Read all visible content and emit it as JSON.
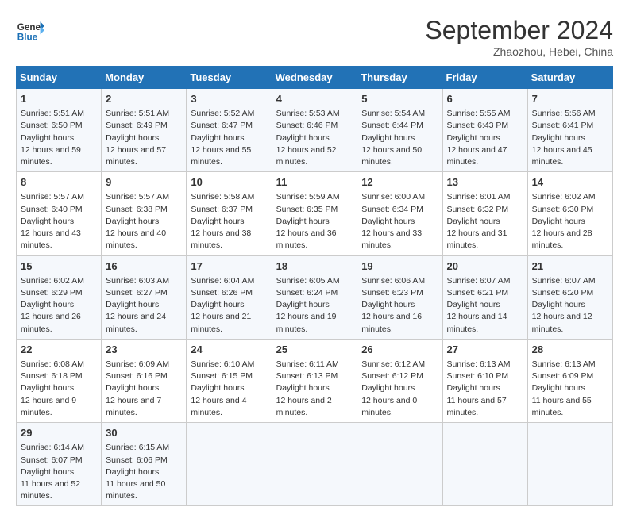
{
  "header": {
    "logo_line1": "General",
    "logo_line2": "Blue",
    "month": "September 2024",
    "location": "Zhaozhou, Hebei, China"
  },
  "weekdays": [
    "Sunday",
    "Monday",
    "Tuesday",
    "Wednesday",
    "Thursday",
    "Friday",
    "Saturday"
  ],
  "weeks": [
    [
      {
        "day": "1",
        "sunrise": "5:51 AM",
        "sunset": "6:50 PM",
        "daylight": "12 hours and 59 minutes."
      },
      {
        "day": "2",
        "sunrise": "5:51 AM",
        "sunset": "6:49 PM",
        "daylight": "12 hours and 57 minutes."
      },
      {
        "day": "3",
        "sunrise": "5:52 AM",
        "sunset": "6:47 PM",
        "daylight": "12 hours and 55 minutes."
      },
      {
        "day": "4",
        "sunrise": "5:53 AM",
        "sunset": "6:46 PM",
        "daylight": "12 hours and 52 minutes."
      },
      {
        "day": "5",
        "sunrise": "5:54 AM",
        "sunset": "6:44 PM",
        "daylight": "12 hours and 50 minutes."
      },
      {
        "day": "6",
        "sunrise": "5:55 AM",
        "sunset": "6:43 PM",
        "daylight": "12 hours and 47 minutes."
      },
      {
        "day": "7",
        "sunrise": "5:56 AM",
        "sunset": "6:41 PM",
        "daylight": "12 hours and 45 minutes."
      }
    ],
    [
      {
        "day": "8",
        "sunrise": "5:57 AM",
        "sunset": "6:40 PM",
        "daylight": "12 hours and 43 minutes."
      },
      {
        "day": "9",
        "sunrise": "5:57 AM",
        "sunset": "6:38 PM",
        "daylight": "12 hours and 40 minutes."
      },
      {
        "day": "10",
        "sunrise": "5:58 AM",
        "sunset": "6:37 PM",
        "daylight": "12 hours and 38 minutes."
      },
      {
        "day": "11",
        "sunrise": "5:59 AM",
        "sunset": "6:35 PM",
        "daylight": "12 hours and 36 minutes."
      },
      {
        "day": "12",
        "sunrise": "6:00 AM",
        "sunset": "6:34 PM",
        "daylight": "12 hours and 33 minutes."
      },
      {
        "day": "13",
        "sunrise": "6:01 AM",
        "sunset": "6:32 PM",
        "daylight": "12 hours and 31 minutes."
      },
      {
        "day": "14",
        "sunrise": "6:02 AM",
        "sunset": "6:30 PM",
        "daylight": "12 hours and 28 minutes."
      }
    ],
    [
      {
        "day": "15",
        "sunrise": "6:02 AM",
        "sunset": "6:29 PM",
        "daylight": "12 hours and 26 minutes."
      },
      {
        "day": "16",
        "sunrise": "6:03 AM",
        "sunset": "6:27 PM",
        "daylight": "12 hours and 24 minutes."
      },
      {
        "day": "17",
        "sunrise": "6:04 AM",
        "sunset": "6:26 PM",
        "daylight": "12 hours and 21 minutes."
      },
      {
        "day": "18",
        "sunrise": "6:05 AM",
        "sunset": "6:24 PM",
        "daylight": "12 hours and 19 minutes."
      },
      {
        "day": "19",
        "sunrise": "6:06 AM",
        "sunset": "6:23 PM",
        "daylight": "12 hours and 16 minutes."
      },
      {
        "day": "20",
        "sunrise": "6:07 AM",
        "sunset": "6:21 PM",
        "daylight": "12 hours and 14 minutes."
      },
      {
        "day": "21",
        "sunrise": "6:07 AM",
        "sunset": "6:20 PM",
        "daylight": "12 hours and 12 minutes."
      }
    ],
    [
      {
        "day": "22",
        "sunrise": "6:08 AM",
        "sunset": "6:18 PM",
        "daylight": "12 hours and 9 minutes."
      },
      {
        "day": "23",
        "sunrise": "6:09 AM",
        "sunset": "6:16 PM",
        "daylight": "12 hours and 7 minutes."
      },
      {
        "day": "24",
        "sunrise": "6:10 AM",
        "sunset": "6:15 PM",
        "daylight": "12 hours and 4 minutes."
      },
      {
        "day": "25",
        "sunrise": "6:11 AM",
        "sunset": "6:13 PM",
        "daylight": "12 hours and 2 minutes."
      },
      {
        "day": "26",
        "sunrise": "6:12 AM",
        "sunset": "6:12 PM",
        "daylight": "12 hours and 0 minutes."
      },
      {
        "day": "27",
        "sunrise": "6:13 AM",
        "sunset": "6:10 PM",
        "daylight": "11 hours and 57 minutes."
      },
      {
        "day": "28",
        "sunrise": "6:13 AM",
        "sunset": "6:09 PM",
        "daylight": "11 hours and 55 minutes."
      }
    ],
    [
      {
        "day": "29",
        "sunrise": "6:14 AM",
        "sunset": "6:07 PM",
        "daylight": "11 hours and 52 minutes."
      },
      {
        "day": "30",
        "sunrise": "6:15 AM",
        "sunset": "6:06 PM",
        "daylight": "11 hours and 50 minutes."
      },
      null,
      null,
      null,
      null,
      null
    ]
  ]
}
